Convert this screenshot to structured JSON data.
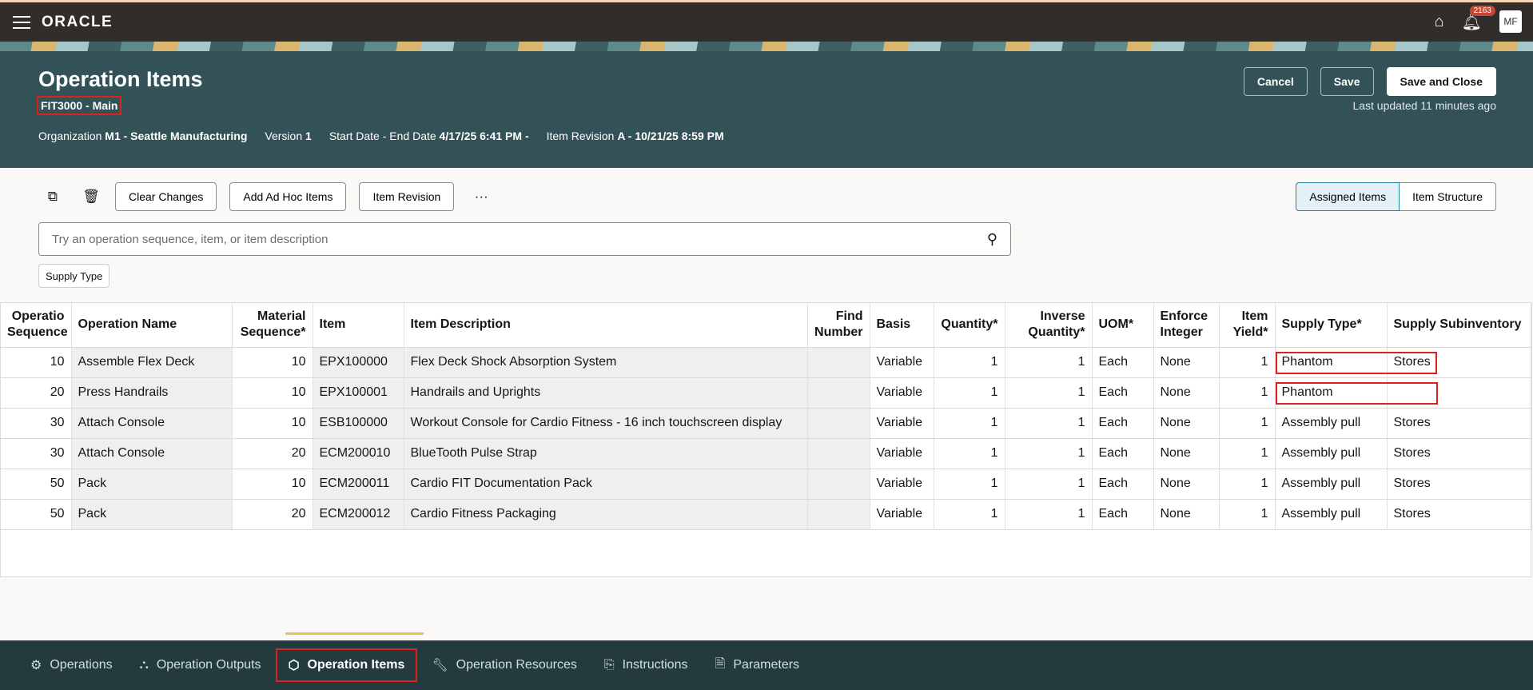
{
  "topbar": {
    "brand": "ORACLE",
    "notifications": "2163",
    "avatar": "MF"
  },
  "header": {
    "title": "Operation Items",
    "subtitle": "FIT3000 - Main",
    "meta": [
      {
        "label": "Organization",
        "value": "M1 - Seattle Manufacturing"
      },
      {
        "label": "Version",
        "value": "1"
      },
      {
        "label": "Start Date - End Date",
        "value": "4/17/25 6:41 PM -"
      },
      {
        "label": "Item Revision",
        "value": "A - 10/21/25 8:59 PM"
      }
    ],
    "cancel": "Cancel",
    "save": "Save",
    "save_close": "Save and Close",
    "last_updated": "Last updated 11 minutes ago"
  },
  "toolbar": {
    "clear": "Clear Changes",
    "adhoc": "Add Ad Hoc Items",
    "revision": "Item Revision",
    "more": "···",
    "assigned": "Assigned Items",
    "structure": "Item Structure"
  },
  "search": {
    "placeholder": "Try an operation sequence, item, or item description"
  },
  "filter_chip": "Supply Type",
  "table": {
    "columns": [
      "Operatio Sequence",
      "Operation Name",
      "Material Sequence*",
      "Item",
      "Item Description",
      "Find Number",
      "Basis",
      "Quantity*",
      "Inverse Quantity*",
      "UOM*",
      "Enforce Integer",
      "Item Yield*",
      "Supply Type*",
      "Supply Subinventory"
    ],
    "rows": [
      [
        "10",
        "Assemble Flex Deck",
        "10",
        "EPX100000",
        "Flex Deck Shock Absorption System",
        "",
        "Variable",
        "1",
        "1",
        "Each",
        "None",
        "1",
        "Phantom",
        "Stores"
      ],
      [
        "20",
        "Press Handrails",
        "10",
        "EPX100001",
        "Handrails and Uprights",
        "",
        "Variable",
        "1",
        "1",
        "Each",
        "None",
        "1",
        "Phantom",
        ""
      ],
      [
        "30",
        "Attach Console",
        "10",
        "ESB100000",
        "Workout Console for Cardio Fitness - 16 inch touchscreen display",
        "",
        "Variable",
        "1",
        "1",
        "Each",
        "None",
        "1",
        "Assembly pull",
        "Stores"
      ],
      [
        "30",
        "Attach Console",
        "20",
        "ECM200010",
        "BlueTooth Pulse Strap",
        "",
        "Variable",
        "1",
        "1",
        "Each",
        "None",
        "1",
        "Assembly pull",
        "Stores"
      ],
      [
        "50",
        "Pack",
        "10",
        "ECM200011",
        "Cardio FIT Documentation Pack",
        "",
        "Variable",
        "1",
        "1",
        "Each",
        "None",
        "1",
        "Assembly pull",
        "Stores"
      ],
      [
        "50",
        "Pack",
        "20",
        "ECM200012",
        "Cardio Fitness Packaging",
        "",
        "Variable",
        "1",
        "1",
        "Each",
        "None",
        "1",
        "Assembly pull",
        "Stores"
      ]
    ]
  },
  "bottom_tabs": [
    {
      "label": "Operations",
      "icon": "gears-icon"
    },
    {
      "label": "Operation Outputs",
      "icon": "outputs-icon"
    },
    {
      "label": "Operation Items",
      "icon": "cube-icon"
    },
    {
      "label": "Operation Resources",
      "icon": "wrench-icon"
    },
    {
      "label": "Instructions",
      "icon": "instructions-icon"
    },
    {
      "label": "Parameters",
      "icon": "parameters-icon"
    }
  ]
}
